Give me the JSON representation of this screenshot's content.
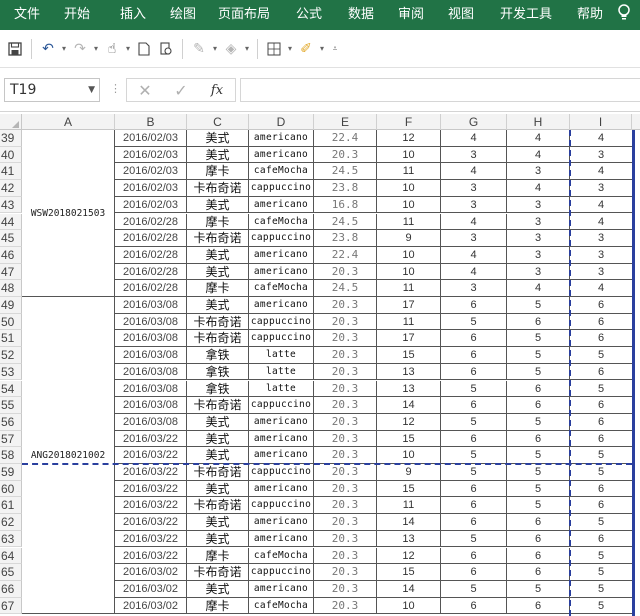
{
  "ribbon": {
    "tabs": [
      "文件",
      "开始",
      "插入",
      "绘图",
      "页面布局",
      "公式",
      "数据",
      "审阅",
      "视图",
      "开发工具",
      "帮助"
    ],
    "tell_icon": "lightbulb-icon"
  },
  "formula_bar": {
    "name_box": "T19",
    "fx_label": "fx",
    "formula": ""
  },
  "columns": [
    "A",
    "B",
    "C",
    "D",
    "E",
    "F",
    "G",
    "H",
    "I"
  ],
  "groups": [
    {
      "label": "WSW2018021503",
      "first_row": 39,
      "last_row": 48
    },
    {
      "label": "ANG2018021002",
      "first_row": 49,
      "last_row": 67
    }
  ],
  "rows": [
    {
      "n": "39",
      "b": "2016/02/03",
      "c": "美式",
      "d": "americano",
      "e": "22.4",
      "f": "12",
      "g": "4",
      "h": "4",
      "i": "4"
    },
    {
      "n": "40",
      "b": "2016/02/03",
      "c": "美式",
      "d": "americano",
      "e": "20.3",
      "f": "10",
      "g": "3",
      "h": "4",
      "i": "3"
    },
    {
      "n": "41",
      "b": "2016/02/03",
      "c": "摩卡",
      "d": "cafeMocha",
      "e": "24.5",
      "f": "11",
      "g": "4",
      "h": "3",
      "i": "4"
    },
    {
      "n": "42",
      "b": "2016/02/03",
      "c": "卡布奇诺",
      "d": "cappuccino",
      "e": "23.8",
      "f": "10",
      "g": "3",
      "h": "4",
      "i": "3"
    },
    {
      "n": "43",
      "b": "2016/02/03",
      "c": "美式",
      "d": "americano",
      "e": "16.8",
      "f": "10",
      "g": "3",
      "h": "3",
      "i": "4"
    },
    {
      "n": "44",
      "b": "2016/02/28",
      "c": "摩卡",
      "d": "cafeMocha",
      "e": "24.5",
      "f": "11",
      "g": "4",
      "h": "3",
      "i": "4"
    },
    {
      "n": "45",
      "b": "2016/02/28",
      "c": "卡布奇诺",
      "d": "cappuccino",
      "e": "23.8",
      "f": "9",
      "g": "3",
      "h": "3",
      "i": "3"
    },
    {
      "n": "46",
      "b": "2016/02/28",
      "c": "美式",
      "d": "americano",
      "e": "22.4",
      "f": "10",
      "g": "4",
      "h": "3",
      "i": "3"
    },
    {
      "n": "47",
      "b": "2016/02/28",
      "c": "美式",
      "d": "americano",
      "e": "20.3",
      "f": "10",
      "g": "4",
      "h": "3",
      "i": "3"
    },
    {
      "n": "48",
      "b": "2016/02/28",
      "c": "摩卡",
      "d": "cafeMocha",
      "e": "24.5",
      "f": "11",
      "g": "3",
      "h": "4",
      "i": "4"
    },
    {
      "n": "49",
      "b": "2016/03/08",
      "c": "美式",
      "d": "americano",
      "e": "20.3",
      "f": "17",
      "g": "6",
      "h": "5",
      "i": "6"
    },
    {
      "n": "50",
      "b": "2016/03/08",
      "c": "卡布奇诺",
      "d": "cappuccino",
      "e": "20.3",
      "f": "11",
      "g": "5",
      "h": "6",
      "i": "6"
    },
    {
      "n": "51",
      "b": "2016/03/08",
      "c": "卡布奇诺",
      "d": "cappuccino",
      "e": "20.3",
      "f": "17",
      "g": "6",
      "h": "5",
      "i": "6"
    },
    {
      "n": "52",
      "b": "2016/03/08",
      "c": "拿铁",
      "d": "latte",
      "e": "20.3",
      "f": "15",
      "g": "6",
      "h": "5",
      "i": "5"
    },
    {
      "n": "53",
      "b": "2016/03/08",
      "c": "拿铁",
      "d": "latte",
      "e": "20.3",
      "f": "13",
      "g": "6",
      "h": "5",
      "i": "6"
    },
    {
      "n": "54",
      "b": "2016/03/08",
      "c": "拿铁",
      "d": "latte",
      "e": "20.3",
      "f": "13",
      "g": "5",
      "h": "6",
      "i": "5"
    },
    {
      "n": "55",
      "b": "2016/03/08",
      "c": "卡布奇诺",
      "d": "cappuccino",
      "e": "20.3",
      "f": "14",
      "g": "6",
      "h": "6",
      "i": "6"
    },
    {
      "n": "56",
      "b": "2016/03/08",
      "c": "美式",
      "d": "americano",
      "e": "20.3",
      "f": "12",
      "g": "5",
      "h": "5",
      "i": "6"
    },
    {
      "n": "57",
      "b": "2016/03/22",
      "c": "美式",
      "d": "americano",
      "e": "20.3",
      "f": "15",
      "g": "6",
      "h": "6",
      "i": "6"
    },
    {
      "n": "58",
      "b": "2016/03/22",
      "c": "美式",
      "d": "americano",
      "e": "20.3",
      "f": "10",
      "g": "5",
      "h": "5",
      "i": "5"
    },
    {
      "n": "59",
      "b": "2016/03/22",
      "c": "卡布奇诺",
      "d": "cappuccino",
      "e": "20.3",
      "f": "9",
      "g": "5",
      "h": "5",
      "i": "5"
    },
    {
      "n": "60",
      "b": "2016/03/22",
      "c": "美式",
      "d": "americano",
      "e": "20.3",
      "f": "15",
      "g": "6",
      "h": "5",
      "i": "6"
    },
    {
      "n": "61",
      "b": "2016/03/22",
      "c": "卡布奇诺",
      "d": "cappuccino",
      "e": "20.3",
      "f": "11",
      "g": "6",
      "h": "5",
      "i": "6"
    },
    {
      "n": "62",
      "b": "2016/03/22",
      "c": "美式",
      "d": "americano",
      "e": "20.3",
      "f": "14",
      "g": "6",
      "h": "6",
      "i": "5"
    },
    {
      "n": "63",
      "b": "2016/03/22",
      "c": "美式",
      "d": "americano",
      "e": "20.3",
      "f": "13",
      "g": "5",
      "h": "6",
      "i": "6"
    },
    {
      "n": "64",
      "b": "2016/03/22",
      "c": "摩卡",
      "d": "cafeMocha",
      "e": "20.3",
      "f": "12",
      "g": "6",
      "h": "6",
      "i": "5"
    },
    {
      "n": "65",
      "b": "2016/03/02",
      "c": "卡布奇诺",
      "d": "cappuccino",
      "e": "20.3",
      "f": "15",
      "g": "6",
      "h": "6",
      "i": "5"
    },
    {
      "n": "66",
      "b": "2016/03/02",
      "c": "美式",
      "d": "americano",
      "e": "20.3",
      "f": "14",
      "g": "5",
      "h": "5",
      "i": "5"
    },
    {
      "n": "67",
      "b": "2016/03/02",
      "c": "摩卡",
      "d": "cafeMocha",
      "e": "20.3",
      "f": "10",
      "g": "6",
      "h": "6",
      "i": "5"
    }
  ],
  "page_breaks": {
    "vertical_after_column": "H",
    "horizontal_after_row": 58
  },
  "colors": {
    "ribbon": "#217346",
    "page_break": "#2a3f9e"
  }
}
